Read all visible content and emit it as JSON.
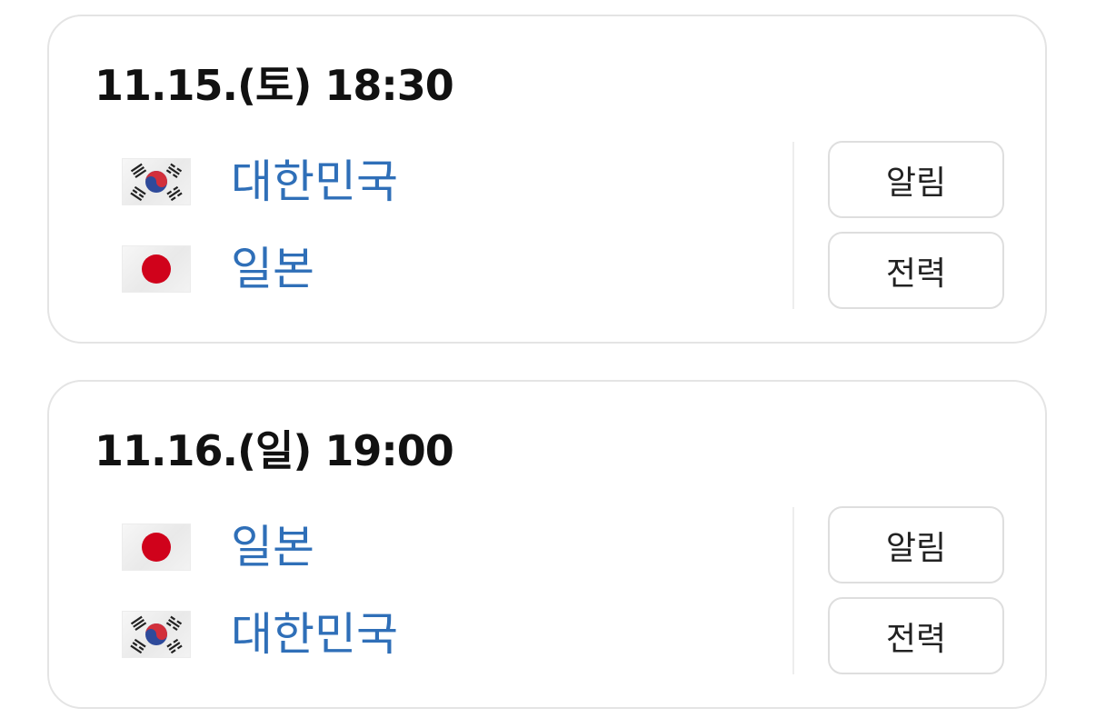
{
  "matches": [
    {
      "datetime": "11.15.(토) 18:30",
      "teams": [
        {
          "name": "대한민국",
          "flag": "south-korea-flag-icon"
        },
        {
          "name": "일본",
          "flag": "japan-flag-icon"
        }
      ],
      "buttons": {
        "alarm_label": "알림",
        "stats_label": "전력"
      }
    },
    {
      "datetime": "11.16.(일) 19:00",
      "teams": [
        {
          "name": "일본",
          "flag": "japan-flag-icon"
        },
        {
          "name": "대한민국",
          "flag": "south-korea-flag-icon"
        }
      ],
      "buttons": {
        "alarm_label": "알림",
        "stats_label": "전력"
      }
    }
  ],
  "colors": {
    "team_name": "#2f6fb8",
    "datetime": "#111111",
    "card_border": "#e4e4e4",
    "japan_red": "#d0021b",
    "korea_red": "#d22f3b",
    "korea_blue": "#2e4a9a"
  }
}
